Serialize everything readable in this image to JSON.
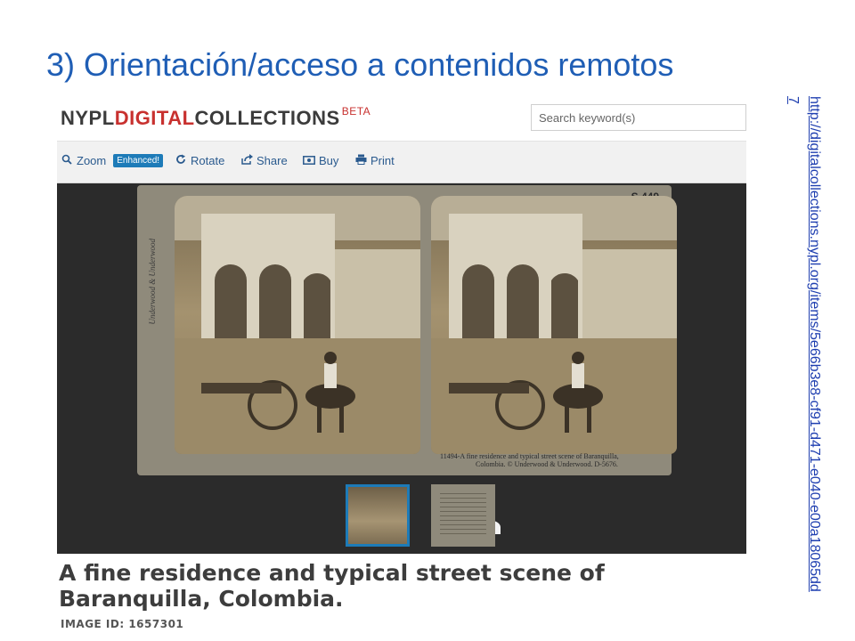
{
  "slide": {
    "title": "3) Orientación/acceso a contenidos remotos",
    "link_text": "http://digitalcollections.nypl.org/items/5e66b3e8-cf91-d471-e040-e00a18065dd7"
  },
  "header": {
    "logo_part1": "NYPL",
    "logo_part2": "DIGITAL",
    "logo_part3": "COLLECTIONS",
    "logo_beta": "BETA",
    "search_placeholder": "Search keyword(s)"
  },
  "toolbar": {
    "zoom_label": "Zoom",
    "enhanced_badge": "Enhanced!",
    "rotate_label": "Rotate",
    "share_label": "Share",
    "buy_label": "Buy",
    "print_label": "Print",
    "icons": [
      "search-icon",
      "rotate-icon",
      "share-icon",
      "buy-icon",
      "print-icon"
    ]
  },
  "viewer": {
    "card_number": "S 449",
    "caption_line1": "11494-A fine residence and typical street scene of Baranquilla,",
    "caption_line2": "Colombia.        © Underwood & Underwood. D-5676.",
    "side_text": "Underwood & Underwood"
  },
  "item": {
    "title": "A fine residence and typical street scene of Baranquilla, Colombia.",
    "image_id": "IMAGE ID:  1657301"
  },
  "colors": {
    "slide_title": "#1f5eb5",
    "logo_accent": "#c8312f",
    "link": "#1f3fb0",
    "toolbar_link": "#2a5a8e",
    "badge": "#1d7bb8"
  }
}
